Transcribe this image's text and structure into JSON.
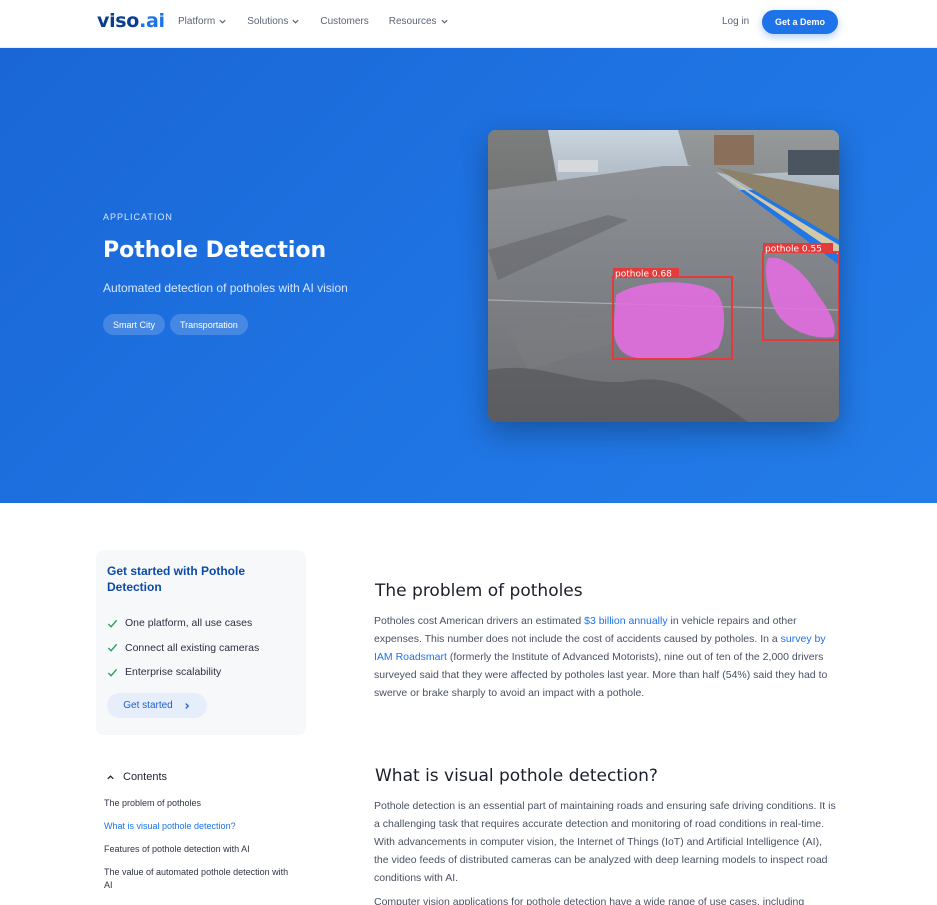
{
  "header": {
    "logo_main": "viso",
    "logo_dot": ".ai",
    "nav": [
      {
        "label": "Platform",
        "has_caret": true
      },
      {
        "label": "Solutions",
        "has_caret": true
      },
      {
        "label": "Customers",
        "has_caret": false
      },
      {
        "label": "Resources",
        "has_caret": true
      }
    ],
    "login": "Log in",
    "demo": "Get a Demo"
  },
  "hero": {
    "eyebrow": "APPLICATION",
    "title": "Pothole Detection",
    "subtitle": "Automated detection of potholes with AI vision",
    "tags": [
      "Smart City",
      "Transportation"
    ],
    "detections": [
      {
        "label": "pothole 0.68"
      },
      {
        "label": "pothole 0.55"
      }
    ]
  },
  "card": {
    "title": "Get started with Pothole Detection",
    "items": [
      "One platform, all use cases",
      "Connect all existing cameras",
      "Enterprise scalability"
    ],
    "button": "Get started"
  },
  "toc": {
    "heading": "Contents",
    "items": [
      {
        "label": "The problem of potholes",
        "active": false
      },
      {
        "label": "What is visual pothole detection?",
        "active": true
      },
      {
        "label": "Features of pothole detection with AI",
        "active": false
      },
      {
        "label": "The value of automated pothole detection with AI",
        "active": false
      }
    ]
  },
  "article": {
    "section1_title": "The problem of potholes",
    "s1_t1": "Potholes cost American drivers an estimated ",
    "s1_link1": "$3 billion annually",
    "s1_t2": " in vehicle repairs and other expenses. This number does not include the cost of accidents caused by potholes. In a ",
    "s1_link2": "survey by IAM Roadsmart",
    "s1_t3": " (formerly the Institute of Advanced Motorists), nine out of ten of the 2,000 drivers surveyed said that they were affected by potholes last year. More than half (54%) said they had to swerve or brake sharply to avoid an impact with a pothole.",
    "section2_title": "What is visual pothole detection?",
    "s2_p1": "Pothole detection is an essential part of maintaining roads and ensuring safe driving conditions. It is a challenging task that requires accurate detection and monitoring of road conditions in real-time. With advancements in computer vision, the Internet of Things (IoT) and Artificial Intelligence (AI), the video feeds of distributed cameras can be analyzed with deep learning models to inspect road conditions with AI.",
    "s2_p2": "Computer vision applications for pothole detection have a wide range of use cases, including"
  }
}
